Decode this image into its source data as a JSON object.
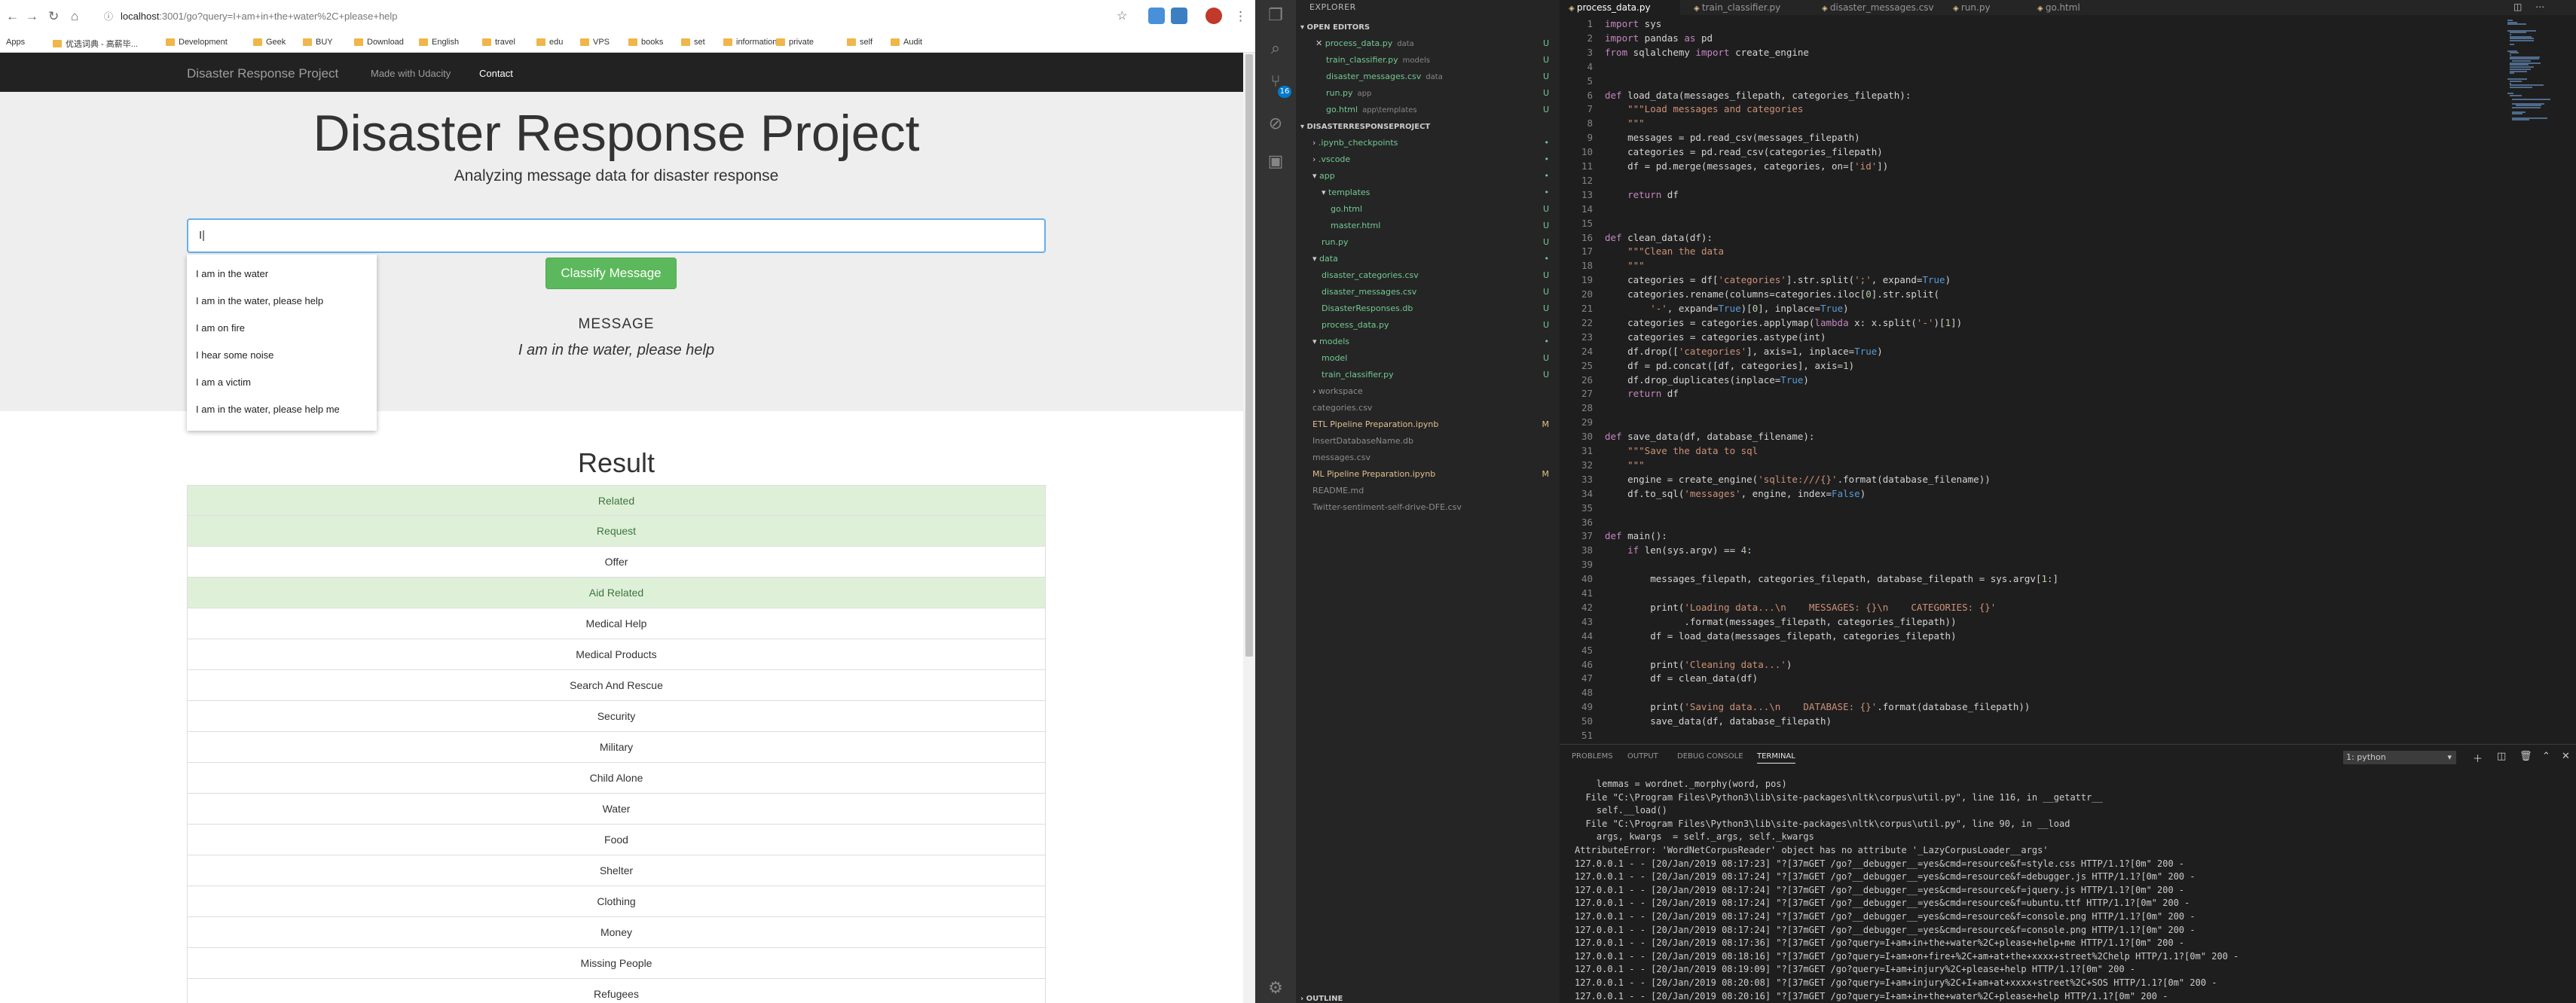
{
  "browser": {
    "url": "localhost:3001/go?query=I+am+in+the+water%2C+please+help",
    "url_host": "localhost",
    "url_rest": ":3001/go?query=I+am+in+the+water%2C+please+help",
    "bookmarks": [
      "Apps",
      "优选词典 - 高薪毕...",
      "Development",
      "Geek",
      "BUY",
      "Download",
      "English",
      "travel",
      "edu",
      "VPS",
      "books",
      "set",
      "information",
      "private",
      "self",
      "Audit"
    ]
  },
  "app": {
    "brand": "Disaster Response Project",
    "nav": [
      "Made with Udacity",
      "Contact"
    ],
    "title": "Disaster Response Project",
    "subtitle": "Analyzing message data for disaster response",
    "query_value": "I",
    "classify_label": "Classify Message",
    "message_label": "MESSAGE",
    "message_text": "I am in the water, please help",
    "autocomplete": [
      "I am in the water",
      "I am in the water, please help",
      "I am on fire",
      "I hear some noise",
      "I am a victim",
      "I am in the water, please help me"
    ],
    "result_title": "Result",
    "results": [
      {
        "label": "Related",
        "positive": true
      },
      {
        "label": "Request",
        "positive": true
      },
      {
        "label": "Offer",
        "positive": false
      },
      {
        "label": "Aid Related",
        "positive": true
      },
      {
        "label": "Medical Help",
        "positive": false
      },
      {
        "label": "Medical Products",
        "positive": false
      },
      {
        "label": "Search And Rescue",
        "positive": false
      },
      {
        "label": "Security",
        "positive": false
      },
      {
        "label": "Military",
        "positive": false
      },
      {
        "label": "Child Alone",
        "positive": false
      },
      {
        "label": "Water",
        "positive": false
      },
      {
        "label": "Food",
        "positive": false
      },
      {
        "label": "Shelter",
        "positive": false
      },
      {
        "label": "Clothing",
        "positive": false
      },
      {
        "label": "Money",
        "positive": false
      },
      {
        "label": "Missing People",
        "positive": false
      },
      {
        "label": "Refugees",
        "positive": false
      }
    ]
  },
  "vscode": {
    "explorer_title": "EXPLORER",
    "open_editors_title": "OPEN EDITORS",
    "open_editors": [
      {
        "name": "process_data.py",
        "hint": "data",
        "status": "U"
      },
      {
        "name": "train_classifier.py",
        "hint": "models",
        "status": "U"
      },
      {
        "name": "disaster_messages.csv",
        "hint": "data",
        "status": "U"
      },
      {
        "name": "run.py",
        "hint": "app",
        "status": "U"
      },
      {
        "name": "go.html",
        "hint": "app\\templates",
        "status": "U"
      }
    ],
    "project_title": "DISASTERRESPONSEPROJECT",
    "tree": [
      {
        "name": ".ipynb_checkpoints",
        "status": "•",
        "indent": 1,
        "color": "green"
      },
      {
        "name": ".vscode",
        "status": "•",
        "indent": 1,
        "color": "green"
      },
      {
        "name": "app",
        "status": "•",
        "indent": 1,
        "color": "green"
      },
      {
        "name": "templates",
        "status": "•",
        "indent": 2,
        "color": "green"
      },
      {
        "name": "go.html",
        "status": "U",
        "indent": 3,
        "color": "green"
      },
      {
        "name": "master.html",
        "status": "U",
        "indent": 3,
        "color": "green"
      },
      {
        "name": "run.py",
        "status": "U",
        "indent": 2,
        "color": "green"
      },
      {
        "name": "data",
        "status": "•",
        "indent": 1,
        "color": "green"
      },
      {
        "name": "disaster_categories.csv",
        "status": "U",
        "indent": 2,
        "color": "green"
      },
      {
        "name": "disaster_messages.csv",
        "status": "U",
        "indent": 2,
        "color": "green"
      },
      {
        "name": "DisasterResponses.db",
        "status": "U",
        "indent": 2,
        "color": "green"
      },
      {
        "name": "process_data.py",
        "status": "U",
        "indent": 2,
        "color": "green"
      },
      {
        "name": "models",
        "status": "•",
        "indent": 1,
        "color": "green"
      },
      {
        "name": "model",
        "status": "U",
        "indent": 2,
        "color": "green"
      },
      {
        "name": "train_classifier.py",
        "status": "U",
        "indent": 2,
        "color": "green"
      },
      {
        "name": "workspace",
        "status": "",
        "indent": 1,
        "color": "gray"
      },
      {
        "name": "categories.csv",
        "status": "",
        "indent": 1,
        "color": "gray"
      },
      {
        "name": "ETL Pipeline Preparation.ipynb",
        "status": "M",
        "indent": 1,
        "color": "yellow"
      },
      {
        "name": "InsertDatabaseName.db",
        "status": "",
        "indent": 1,
        "color": "gray"
      },
      {
        "name": "messages.csv",
        "status": "",
        "indent": 1,
        "color": "gray"
      },
      {
        "name": "ML Pipeline Preparation.ipynb",
        "status": "M",
        "indent": 1,
        "color": "yellow"
      },
      {
        "name": "README.md",
        "status": "",
        "indent": 1,
        "color": "gray"
      },
      {
        "name": "Twitter-sentiment-self-drive-DFE.csv",
        "status": "",
        "indent": 1,
        "color": "gray"
      }
    ],
    "outline_title": "OUTLINE",
    "tabs": [
      "process_data.py",
      "train_classifier.py",
      "disaster_messages.csv",
      "run.py",
      "go.html"
    ],
    "code": [
      "import sys",
      "import pandas as pd",
      "from sqlalchemy import create_engine",
      "",
      "",
      "def load_data(messages_filepath, categories_filepath):",
      "    \"\"\"Load messages and categories",
      "    \"\"\"",
      "    messages = pd.read_csv(messages_filepath)",
      "    categories = pd.read_csv(categories_filepath)",
      "    df = pd.merge(messages, categories, on=['id'])",
      "",
      "    return df",
      "",
      "",
      "def clean_data(df):",
      "    \"\"\"Clean the data",
      "    \"\"\"",
      "    categories = df['categories'].str.split(';', expand=True)",
      "    categories.rename(columns=categories.iloc[0].str.split(",
      "        '-', expand=True)[0], inplace=True)",
      "    categories = categories.applymap(lambda x: x.split('-')[1])",
      "    categories = categories.astype(int)",
      "    df.drop(['categories'], axis=1, inplace=True)",
      "    df = pd.concat([df, categories], axis=1)",
      "    df.drop_duplicates(inplace=True)",
      "    return df",
      "",
      "",
      "def save_data(df, database_filename):",
      "    \"\"\"Save the data to sql",
      "    \"\"\"",
      "    engine = create_engine('sqlite:///{}'.format(database_filename))",
      "    df.to_sql('messages', engine, index=False)",
      "",
      "",
      "def main():",
      "    if len(sys.argv) == 4:",
      "",
      "        messages_filepath, categories_filepath, database_filepath = sys.argv[1:]",
      "",
      "        print('Loading data...\\n    MESSAGES: {}\\n    CATEGORIES: {}'",
      "              .format(messages_filepath, categories_filepath))",
      "        df = load_data(messages_filepath, categories_filepath)",
      "",
      "        print('Cleaning data...')",
      "        df = clean_data(df)",
      "",
      "        print('Saving data...\\n    DATABASE: {}'.format(database_filepath))",
      "        save_data(df, database_filepath)",
      ""
    ],
    "panel_tabs": [
      "PROBLEMS",
      "OUTPUT",
      "DEBUG CONSOLE",
      "TERMINAL"
    ],
    "terminal_select": "1: python",
    "terminal": [
      "    lemmas = wordnet._morphy(word, pos)",
      "  File \"C:\\Program Files\\Python3\\lib\\site-packages\\nltk\\corpus\\util.py\", line 116, in __getattr__",
      "    self.__load()",
      "  File \"C:\\Program Files\\Python3\\lib\\site-packages\\nltk\\corpus\\util.py\", line 90, in __load",
      "    args, kwargs  = self._args, self._kwargs",
      "AttributeError: 'WordNetCorpusReader' object has no attribute '_LazyCorpusLoader__args'",
      "127.0.0.1 - - [20/Jan/2019 08:17:23] \"?[37mGET /go?__debugger__=yes&cmd=resource&f=style.css HTTP/1.1?[0m\" 200 -",
      "127.0.0.1 - - [20/Jan/2019 08:17:24] \"?[37mGET /go?__debugger__=yes&cmd=resource&f=debugger.js HTTP/1.1?[0m\" 200 -",
      "127.0.0.1 - - [20/Jan/2019 08:17:24] \"?[37mGET /go?__debugger__=yes&cmd=resource&f=jquery.js HTTP/1.1?[0m\" 200 -",
      "127.0.0.1 - - [20/Jan/2019 08:17:24] \"?[37mGET /go?__debugger__=yes&cmd=resource&f=ubuntu.ttf HTTP/1.1?[0m\" 200 -",
      "127.0.0.1 - - [20/Jan/2019 08:17:24] \"?[37mGET /go?__debugger__=yes&cmd=resource&f=console.png HTTP/1.1?[0m\" 200 -",
      "127.0.0.1 - - [20/Jan/2019 08:17:24] \"?[37mGET /go?__debugger__=yes&cmd=resource&f=console.png HTTP/1.1?[0m\" 200 -",
      "127.0.0.1 - - [20/Jan/2019 08:17:36] \"?[37mGET /go?query=I+am+in+the+water%2C+please+help+me HTTP/1.1?[0m\" 200 -",
      "127.0.0.1 - - [20/Jan/2019 08:18:16] \"?[37mGET /go?query=I+am+on+fire+%2C+am+at+the+xxxx+street%2Chelp HTTP/1.1?[0m\" 200 -",
      "127.0.0.1 - - [20/Jan/2019 08:19:09] \"?[37mGET /go?query=I+am+injury%2C+please+help HTTP/1.1?[0m\" 200 -",
      "127.0.0.1 - - [20/Jan/2019 08:20:08] \"?[37mGET /go?query=I+am+injury%2C+I+am+at+xxxx+street%2C+SOS HTTP/1.1?[0m\" 200 -",
      "127.0.0.1 - - [20/Jan/2019 08:20:16] \"?[37mGET /go?query=I+am+in+the+water%2C+please+help HTTP/1.1?[0m\" 200 -",
      ""
    ]
  }
}
